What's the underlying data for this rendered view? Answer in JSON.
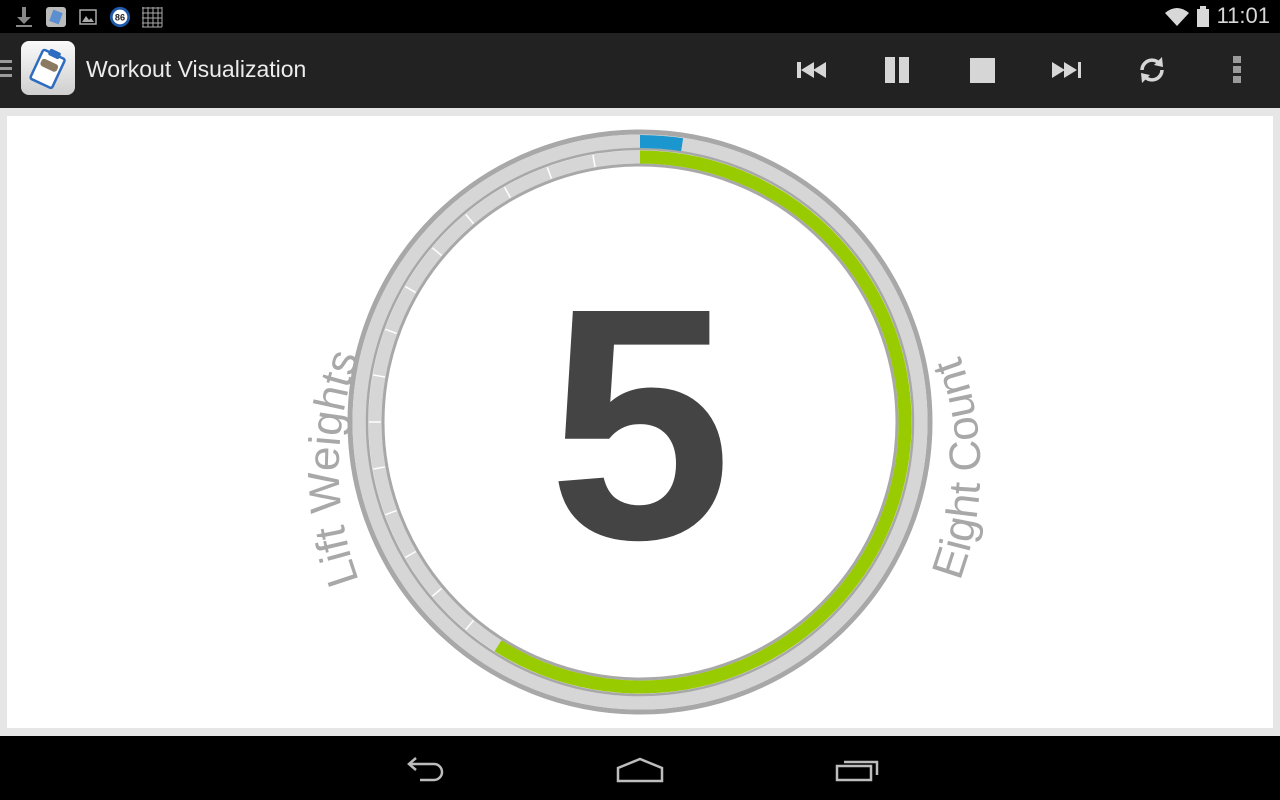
{
  "status_bar": {
    "time": "11:01",
    "notification_icons": [
      "download-icon",
      "app-notification-icon",
      "image-icon",
      "badge-86-icon",
      "grid-icon"
    ],
    "badge_value": "86",
    "system_icons": [
      "wifi-icon",
      "battery-icon"
    ]
  },
  "action_bar": {
    "title": "Workout Visualization",
    "buttons": [
      {
        "name": "previous",
        "icon": "skip-previous-icon"
      },
      {
        "name": "pause",
        "icon": "pause-icon"
      },
      {
        "name": "stop",
        "icon": "stop-icon"
      },
      {
        "name": "next",
        "icon": "skip-next-icon"
      },
      {
        "name": "repeat",
        "icon": "sync-icon"
      },
      {
        "name": "overflow",
        "icon": "more-vert-icon"
      }
    ]
  },
  "workout": {
    "count": "5",
    "exercise_label": "Lift Weights",
    "count_type_label": "Eight Count",
    "overall_progress": 0.024,
    "exercise_progress": 0.59,
    "colors": {
      "overall": "#1b96cf",
      "exercise": "#99cc00",
      "track": "#d6d6d6",
      "border": "#a8a8a8",
      "number": "#444444",
      "label": "#a8a8a8"
    }
  },
  "nav_bar": {
    "buttons": [
      "back",
      "home",
      "recents"
    ]
  }
}
